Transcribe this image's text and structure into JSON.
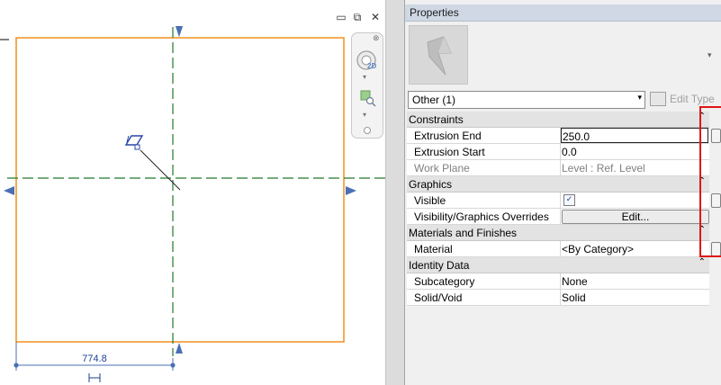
{
  "canvas": {
    "dimension_value": "774.8",
    "window_controls": {
      "minimize": "▭",
      "restore": "⧉",
      "close": "✕"
    },
    "navbar": {
      "close_glyph": "⊗",
      "wheel_label": "2D",
      "down_arrow": "▾"
    }
  },
  "properties": {
    "title": "Properties",
    "type_selector_arrow": "▾",
    "selector": {
      "value": "Other (1)",
      "arrow": "▾"
    },
    "edit_type_label": "Edit Type",
    "collapse_glyph": "⌃",
    "sections": [
      {
        "title": "Constraints",
        "rows": [
          {
            "key": "Extrusion End",
            "value": "250.0"
          },
          {
            "key": "Extrusion Start",
            "value": "0.0"
          },
          {
            "key": "Work Plane",
            "value": "Level : Ref. Level"
          }
        ]
      },
      {
        "title": "Graphics",
        "rows": [
          {
            "key": "Visible",
            "value": "✓"
          },
          {
            "key": "Visibility/Graphics Overrides",
            "value": "Edit..."
          }
        ]
      },
      {
        "title": "Materials and Finishes",
        "rows": [
          {
            "key": "Material",
            "value": "<By Category>"
          }
        ]
      },
      {
        "title": "Identity Data",
        "rows": [
          {
            "key": "Subcategory",
            "value": "None"
          },
          {
            "key": "Solid/Void",
            "value": "Solid"
          }
        ]
      }
    ]
  },
  "colors": {
    "extrusion_outline": "#f0901a",
    "reference_plane": "#1f7a2a",
    "annotation_blue": "#4a6fb5",
    "title_bar": "#cfd8e4",
    "highlight_red": "#e01515"
  },
  "icons": [
    "minimize-icon",
    "restore-icon",
    "close-icon",
    "navigation-wheel-icon",
    "zoom-icon",
    "edit-type-icon",
    "collapse-icon",
    "work-plane-icon"
  ]
}
